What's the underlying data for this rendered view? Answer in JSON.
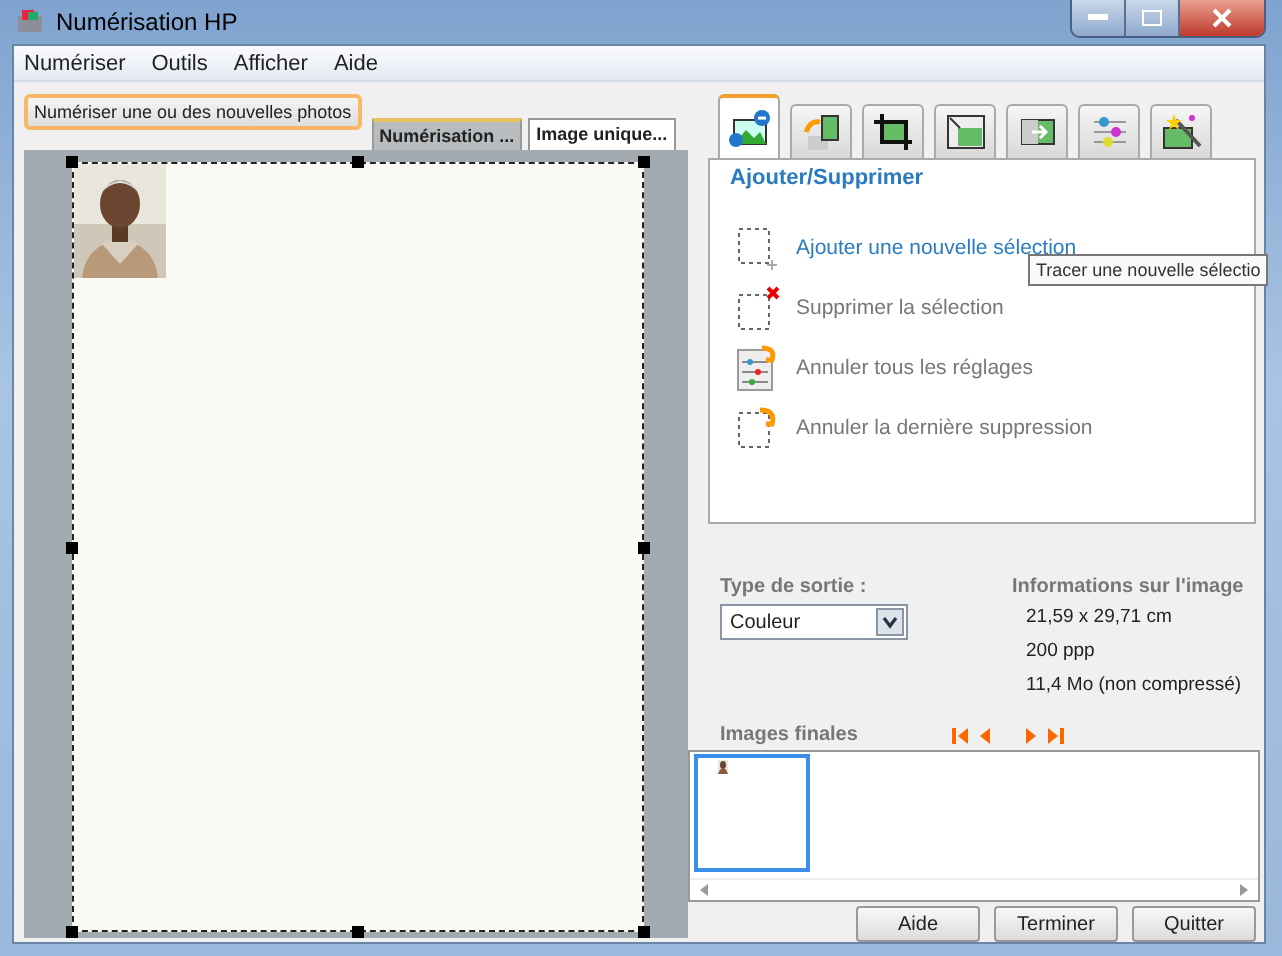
{
  "window": {
    "title": "Numérisation HP"
  },
  "menu": [
    "Numériser",
    "Outils",
    "Afficher",
    "Aide"
  ],
  "scan_button": "Numériser une ou des nouvelles photos",
  "preview_tabs": [
    {
      "label": "Numérisation ...",
      "selected": true
    },
    {
      "label": "Image unique...",
      "selected": false
    }
  ],
  "preview": {
    "kind": "picture"
  },
  "tool_tabs": [
    {
      "kind": "add-remove",
      "selected": true
    },
    {
      "kind": "rotate",
      "selected": false
    },
    {
      "kind": "crop",
      "selected": false
    },
    {
      "kind": "resize",
      "selected": false
    },
    {
      "kind": "mirror",
      "selected": false
    },
    {
      "kind": "adjust",
      "selected": false
    },
    {
      "kind": "enhance",
      "selected": false
    }
  ],
  "panel": {
    "title": "Ajouter/Supprimer",
    "actions": [
      {
        "kind": "add",
        "label": "Ajouter une nouvelle sélection",
        "disabled": false
      },
      {
        "kind": "delete",
        "label": "Supprimer la sélection",
        "disabled": true
      },
      {
        "kind": "reset",
        "label": "Annuler tous les réglages",
        "disabled": true
      },
      {
        "kind": "undo",
        "label": "Annuler la dernière suppression",
        "disabled": true
      }
    ]
  },
  "tooltip": "Tracer une nouvelle sélectio",
  "output": {
    "label": "Type de sortie :",
    "value": "Couleur"
  },
  "info": {
    "title": "Informations sur l'image",
    "lines": [
      "21,59 x 29,71 cm",
      "200 ppp",
      "11,4 Mo (non compressé)"
    ]
  },
  "final_images": {
    "label": "Images finales",
    "thumbnails": [
      {
        "selected": true
      }
    ]
  },
  "buttons": [
    "Aide",
    "Terminer",
    "Quitter"
  ]
}
